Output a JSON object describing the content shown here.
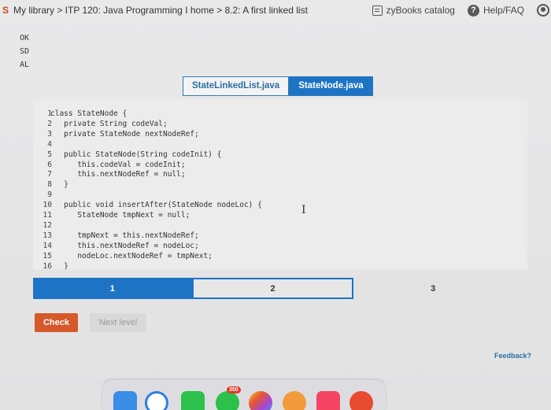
{
  "header": {
    "logo_text": "S",
    "breadcrumb": "My library > ITP 120: Java Programming I home > 8.2: A first linked list",
    "catalog_label": "zyBooks catalog",
    "help_label": "Help/FAQ"
  },
  "codes": [
    "OK",
    "SD",
    "AL"
  ],
  "tabs": [
    {
      "label": "StateLinkedList.java",
      "active": false
    },
    {
      "label": "StateNode.java",
      "active": true
    }
  ],
  "editor": {
    "line_numbers": [
      "1",
      "2",
      "3",
      "4",
      "5",
      "6",
      "7",
      "8",
      "9",
      "10",
      "11",
      "12",
      "13",
      "14",
      "15",
      "16"
    ],
    "code_lines": [
      "class StateNode {",
      "   private String codeVal;",
      "   private StateNode nextNodeRef;",
      "",
      "   public StateNode(String codeInit) {",
      "      this.codeVal = codeInit;",
      "      this.nextNodeRef = null;",
      "   }",
      "",
      "   public void insertAfter(StateNode nodeLoc) {",
      "      StateNode tmpNext = null;",
      "",
      "      tmpNext = this.nextNodeRef;",
      "      this.nextNodeRef = nodeLoc;",
      "      nodeLoc.nextNodeRef = tmpNext;",
      "   }"
    ]
  },
  "levels": [
    {
      "label": "1",
      "state": "done"
    },
    {
      "label": "2",
      "state": "current"
    },
    {
      "label": "3",
      "state": "future"
    }
  ],
  "buttons": {
    "check_label": "Check",
    "next_label": "Next level"
  },
  "feedback_label": "Feedback?",
  "dock": {
    "badge_count": "350",
    "apps": [
      "launchpad-icon",
      "safari-icon",
      "facetime-icon",
      "messages-icon",
      "photos-icon",
      "reminders-icon",
      "music-icon",
      "chrome-icon"
    ]
  },
  "colors": {
    "accent_blue": "#1d73c4",
    "check_orange": "#d6582b",
    "logo_orange": "#d0491b"
  }
}
